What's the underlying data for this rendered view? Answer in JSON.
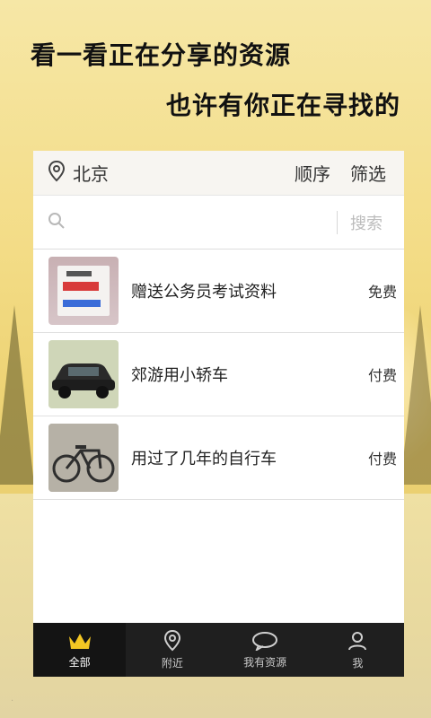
{
  "headline": {
    "line1": "看一看正在分享的资源",
    "line2": "也许有你正在寻找的"
  },
  "topbar": {
    "location_icon": "location-pin-icon",
    "city": "北京",
    "sort_label": "顺序",
    "filter_label": "筛选"
  },
  "search": {
    "search_icon": "search-icon",
    "placeholder": "",
    "button_label": "搜索"
  },
  "resources": [
    {
      "title": "赠送公务员考试资料",
      "price": "免费",
      "thumb_icon": "document-icon"
    },
    {
      "title": "郊游用小轿车",
      "price": "付费",
      "thumb_icon": "car-icon"
    },
    {
      "title": "用过了几年的自行车",
      "price": "付费",
      "thumb_icon": "bicycle-icon"
    }
  ],
  "tabbar": {
    "tabs": [
      {
        "label": "全部",
        "icon": "crown-icon",
        "active": true
      },
      {
        "label": "附近",
        "icon": "location-pin-icon",
        "active": false
      },
      {
        "label": "我有资源",
        "icon": "chat-bubble-icon",
        "active": false
      },
      {
        "label": "我",
        "icon": "user-icon",
        "active": false
      }
    ]
  },
  "colors": {
    "background": "#f3dc86",
    "crown": "#f3c623",
    "tabbar": "#1f1f1f",
    "tab_active": "#141414"
  }
}
